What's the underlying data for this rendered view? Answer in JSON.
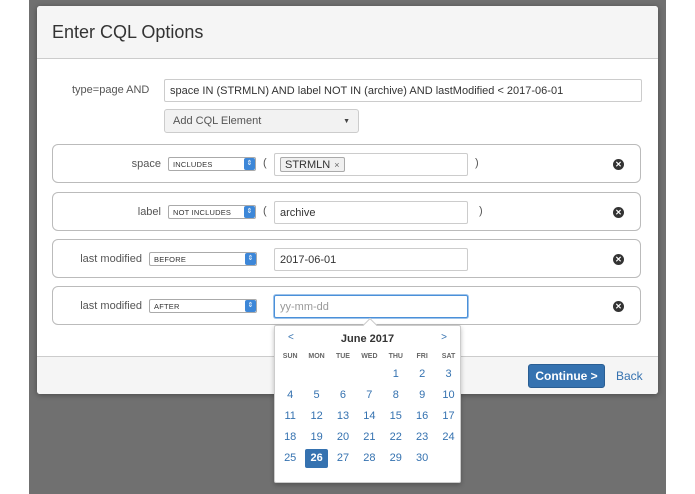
{
  "dialog": {
    "title": "Enter CQL Options",
    "continue_label": "Continue >",
    "back_label": "Back"
  },
  "query": {
    "label": "type=page AND",
    "value": "space IN (STRMLN) AND label NOT IN (archive) AND lastModified < 2017-06-01",
    "add_element_label": "Add CQL Element"
  },
  "rows": [
    {
      "label": "space",
      "operator": "INCLUDES",
      "open_paren": "(",
      "close_paren": ")",
      "token": "STRMLN",
      "token_remove": "×"
    },
    {
      "label": "label",
      "operator": "NOT INCLUDES",
      "open_paren": "(",
      "close_paren": ")",
      "value": "archive"
    },
    {
      "label": "last modified",
      "operator": "BEFORE",
      "value": "2017-06-01"
    },
    {
      "label": "last modified",
      "operator": "AFTER",
      "placeholder": "yy-mm-dd"
    }
  ],
  "datepicker": {
    "prev": "<",
    "next": ">",
    "title": "June 2017",
    "weekdays": [
      "SUN",
      "MON",
      "TUE",
      "WED",
      "THU",
      "FRI",
      "SAT"
    ],
    "days": [
      "",
      "",
      "",
      "",
      "1",
      "2",
      "3",
      "4",
      "5",
      "6",
      "7",
      "8",
      "9",
      "10",
      "11",
      "12",
      "13",
      "14",
      "15",
      "16",
      "17",
      "18",
      "19",
      "20",
      "21",
      "22",
      "23",
      "24",
      "25",
      "26",
      "27",
      "28",
      "29",
      "30",
      ""
    ],
    "selected_day": "26"
  },
  "colors": {
    "accent": "#3572b0",
    "backdrop": "#707070"
  }
}
